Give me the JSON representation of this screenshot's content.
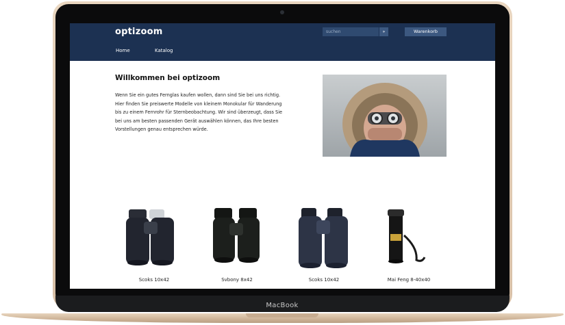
{
  "device": {
    "brand": "MacBook"
  },
  "site": {
    "logo": "optizoom",
    "search": {
      "placeholder": "suchen",
      "button": "»"
    },
    "cart_label": "Warenkorb",
    "nav": [
      "Home",
      "Katalog"
    ]
  },
  "welcome": {
    "title": "Willkommen bei optizoom",
    "text": "Wenn Sie ein gutes Fernglas kaufen wollen, dann sind Sie bei uns richtig. Hier finden Sie preiswerte Modelle von kleinem Monokular für Wanderung bis zu einem Fernrohr für Sternbeobachtung. Wir sind überzeugt, dass Sie bei uns am besten passenden Gerät auswählen können, das Ihre besten Vorstellungen genau entsprechen würde."
  },
  "products": [
    {
      "name": "Scoks 10x42",
      "color": "#22252f"
    },
    {
      "name": "Svbony 8x42",
      "color": "#1c1f1c"
    },
    {
      "name": "Scoks 10x42",
      "color": "#2d3446"
    },
    {
      "name": "Mai Feng 8-40x40",
      "color": "#151515"
    }
  ]
}
